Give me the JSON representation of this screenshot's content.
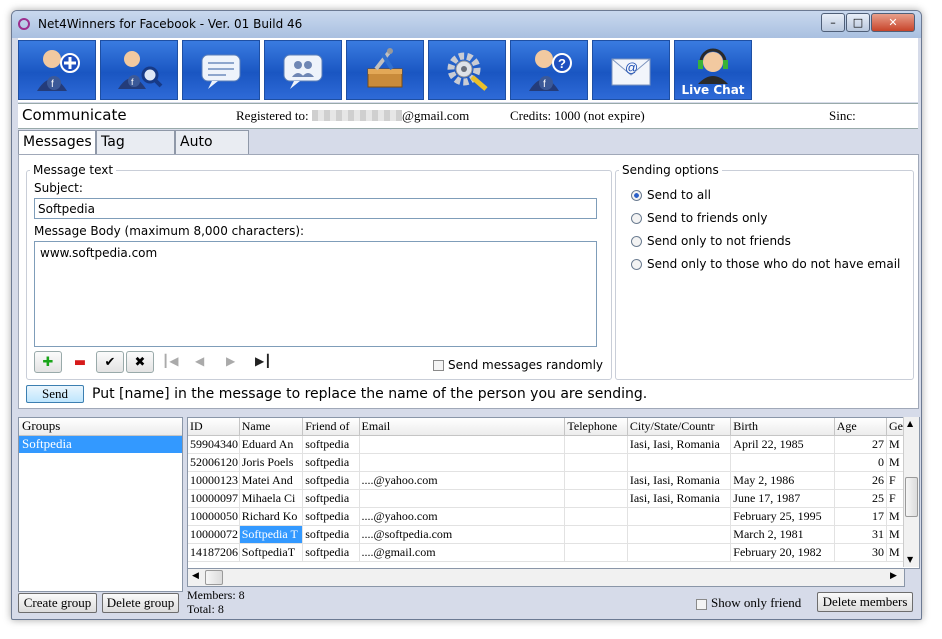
{
  "window": {
    "title": "Net4Winners for Facebook - Ver. 01 Build 46"
  },
  "toolbar": {
    "live_chat_label": "Live Chat"
  },
  "status": {
    "section": "Communicate",
    "registered_label": "Registered to:",
    "registered_email": "@gmail.com",
    "credits": "Credits: 1000 (not expire)",
    "sinc": "Sinc:"
  },
  "tabs": [
    {
      "label": "Messages"
    },
    {
      "label": "Tag image"
    },
    {
      "label": "Auto Post"
    }
  ],
  "message": {
    "group_label": "Message text",
    "subject_label": "Subject:",
    "subject_value": "Softpedia",
    "body_label": "Message Body (maximum 8,000 characters):",
    "body_value": "www.softpedia.com",
    "random_label": "Send messages randomly",
    "send_label": "Send",
    "hint": "Put [name] in the message to replace the name of the person you are sending."
  },
  "sending_options": {
    "label": "Sending options",
    "options": [
      "Send to all",
      "Send to friends only",
      "Send only to not friends",
      "Send only to those who do not have email"
    ],
    "selected": 0
  },
  "groups": {
    "header": "Groups",
    "items": [
      "Softpedia"
    ]
  },
  "grid": {
    "columns": [
      "ID",
      "Name",
      "Friend of",
      "Email",
      "Telephone",
      "City/State/Countr",
      "Birth",
      "Age",
      "Gend"
    ],
    "rows": [
      [
        "59904340",
        "Eduard An",
        "softpedia",
        "",
        "",
        "Iasi, Iasi, Romania",
        "April 22, 1985",
        "27",
        "M"
      ],
      [
        "52006120",
        "Joris Poels",
        "softpedia",
        "",
        "",
        "",
        "",
        "0",
        "M"
      ],
      [
        "10000123",
        "Matei And",
        "softpedia",
        "....@yahoo.com",
        "",
        "Iasi, Iasi, Romania",
        "May 2, 1986",
        "26",
        "F"
      ],
      [
        "10000097",
        "Mihaela Ci",
        "softpedia",
        "",
        "",
        "Iasi, Iasi, Romania",
        "June 17, 1987",
        "25",
        "F"
      ],
      [
        "10000050",
        "Richard Ko",
        "softpedia",
        "....@yahoo.com",
        "",
        "",
        "February 25, 1995",
        "17",
        "M"
      ],
      [
        "10000072",
        "Softpedia T",
        "softpedia",
        "....@softpedia.com",
        "",
        "",
        "March 2, 1981",
        "31",
        "M"
      ],
      [
        "14187206",
        "SoftpediaT",
        "softpedia",
        "....@gmail.com",
        "",
        "",
        "February 20, 1982",
        "30",
        "M"
      ]
    ],
    "selected_row": 5
  },
  "footer": {
    "create_group": "Create group",
    "delete_group": "Delete group",
    "members": "Members: 8",
    "total": "Total: 8",
    "show_only_friend": "Show only friend",
    "delete_members": "Delete members"
  }
}
